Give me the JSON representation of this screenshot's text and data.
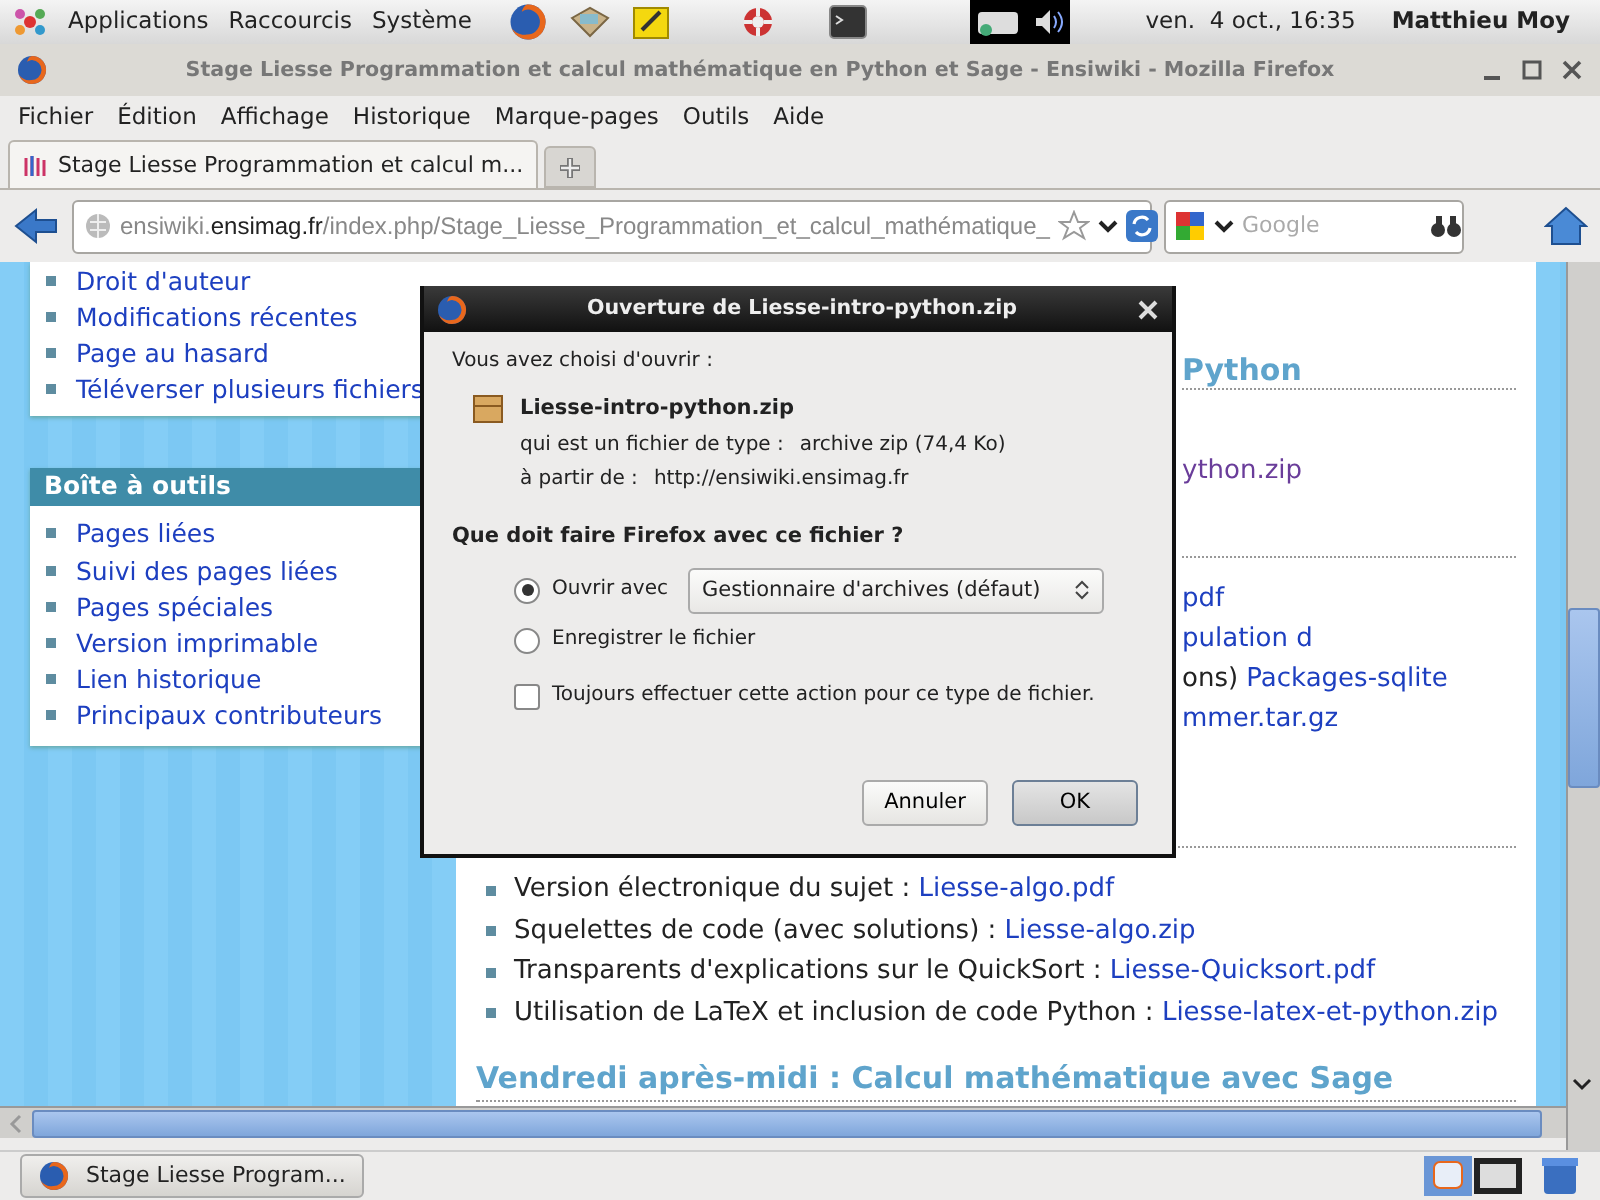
{
  "top_panel": {
    "menus": [
      "Applications",
      "Raccourcis",
      "Système"
    ],
    "clock": "ven.  4 oct., 16:35",
    "user": "Matthieu Moy"
  },
  "window": {
    "title": "Stage Liesse Programmation et calcul mathématique en Python et Sage - Ensiwiki - Mozilla Firefox"
  },
  "menu": [
    "Fichier",
    "Édition",
    "Affichage",
    "Historique",
    "Marque-pages",
    "Outils",
    "Aide"
  ],
  "tabs": [
    {
      "label": "Stage Liesse Programmation et calcul m...",
      "selected": true
    }
  ],
  "address": {
    "subdomain": "ensiwiki.",
    "domain": "ensimag.fr",
    "path": "/index.php/Stage_Liesse_Programmation_et_calcul_mathématique_"
  },
  "search": {
    "placeholder": "Google"
  },
  "sidebar": [
    {
      "items": [
        "Droit d'auteur",
        "Modifications récentes",
        "Page au hasard",
        "Téléverser plusieurs fichiers"
      ]
    },
    {
      "heading": "Boîte à outils",
      "items": [
        "Pages liées",
        "Suivi des pages liées",
        "Pages spéciales",
        "Version imprimable",
        "Lien historique",
        "Principaux contributeurs"
      ]
    }
  ],
  "content": {
    "sections": [
      {
        "heading": "Python",
        "items": [
          {
            "link": "ython.zip",
            "visited": true
          }
        ]
      },
      {
        "items": [
          {
            "link": "pdf",
            "visited": false
          },
          {
            "link": "pulation d",
            "visited": false
          },
          {
            "text": "ons) ",
            "link": "Packages-sqlite",
            "visited": false
          },
          {
            "link": "mmer.tar.gz",
            "visited": false
          }
        ]
      }
    ],
    "list": [
      {
        "text": "Version électronique du sujet : ",
        "link": "Liesse-algo.pdf"
      },
      {
        "text": "Squelettes de code (avec solutions) : ",
        "link": "Liesse-algo.zip"
      },
      {
        "text": "Transparents d'explications sur le QuickSort : ",
        "link": "Liesse-Quicksort.pdf"
      },
      {
        "text": "Utilisation de LaTeX et inclusion de code Python : ",
        "link": "Liesse-latex-et-python.zip"
      }
    ],
    "heading": "Vendredi après-midi : Calcul mathématique avec Sage"
  },
  "dialog": {
    "title": "Ouverture de Liesse-intro-python.zip",
    "intro": "Vous avez choisi d'ouvrir :",
    "filename": "Liesse-intro-python.zip",
    "type_label": "qui est un fichier de type :",
    "type": "archive zip (74,4 Ko)",
    "from_label": "à partir de :",
    "from": "http://ensiwiki.ensimag.fr",
    "question": "Que doit faire Firefox avec ce fichier ?",
    "options": [
      {
        "label": "Ouvrir avec",
        "selected": true,
        "app": "Gestionnaire d'archives (défaut)"
      },
      {
        "label": "Enregistrer le fichier",
        "selected": false
      }
    ],
    "always": {
      "label": "Toujours effectuer cette action pour ce type de fichier.",
      "checked": false
    },
    "buttons": [
      {
        "label": "Annuler",
        "default": false
      },
      {
        "label": "OK",
        "default": true
      }
    ]
  },
  "taskbar": [
    {
      "label": "Stage Liesse Program...",
      "selected": false
    }
  ]
}
